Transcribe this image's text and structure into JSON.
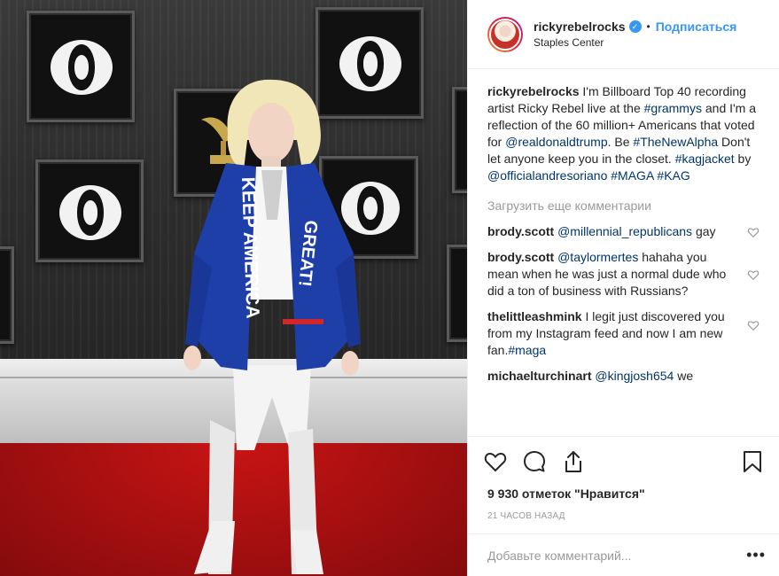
{
  "header": {
    "username": "rickyrebelrocks",
    "separator": "•",
    "follow_label": "Подписаться",
    "location": "Staples Center"
  },
  "caption": {
    "username": "rickyrebelrocks",
    "segments": [
      {
        "text": "I'm Billboard Top 40 recording artist Ricky Rebel live at the ",
        "link": false
      },
      {
        "text": "#grammys",
        "link": true
      },
      {
        "text": " and I'm a reflection of the 60 million+ Americans that voted for ",
        "link": false
      },
      {
        "text": "@realdonaldtrump",
        "link": true
      },
      {
        "text": ". Be ",
        "link": false
      },
      {
        "text": "#TheNewAlpha",
        "link": true
      },
      {
        "text": " Don't let anyone keep you in the closet. ",
        "link": false
      },
      {
        "text": "#kagjacket",
        "link": true
      },
      {
        "text": " by ",
        "link": false
      },
      {
        "text": "@officialandresoriano",
        "link": true
      },
      {
        "text": " ",
        "link": false
      },
      {
        "text": "#MAGA",
        "link": true
      },
      {
        "text": " ",
        "link": false
      },
      {
        "text": "#KAG",
        "link": true
      }
    ]
  },
  "load_more_label": "Загрузить еще комментарии",
  "comments": [
    {
      "username": "brody.scott",
      "mention": "@millennial_republicans",
      "text": " gay",
      "tail_tag": ""
    },
    {
      "username": "brody.scott",
      "mention": "@taylormertes",
      "text": " hahaha you mean when he was just a normal dude who did a ton of business with Russians?",
      "tail_tag": ""
    },
    {
      "username": "thelittleashmink",
      "mention": "",
      "text": "I legit just discovered you from my Instagram feed and now I am new fan.",
      "tail_tag": "#maga"
    },
    {
      "username": "michaelturchinart",
      "mention": "@kingjosh654",
      "text": " we",
      "tail_tag": ""
    }
  ],
  "actions": {
    "like_icon": "heart-icon",
    "comment_icon": "comment-icon",
    "share_icon": "share-icon",
    "save_icon": "bookmark-icon"
  },
  "likes_text": "9 930 отметок \"Нравится\"",
  "timestamp": "21 часов назад",
  "add_comment": {
    "placeholder": "Добавьте комментарий...",
    "more_label": "•••"
  },
  "photo": {
    "jacket_text_left": "KEEP AMERICA",
    "jacket_text_right": "GREAT!",
    "colors": {
      "carpet": "#a40f10",
      "jacket": "#1f3fa8",
      "wall": "#2e2e2e"
    }
  },
  "colors": {
    "link": "#003569",
    "accent": "#3897f0",
    "muted": "#999999"
  }
}
